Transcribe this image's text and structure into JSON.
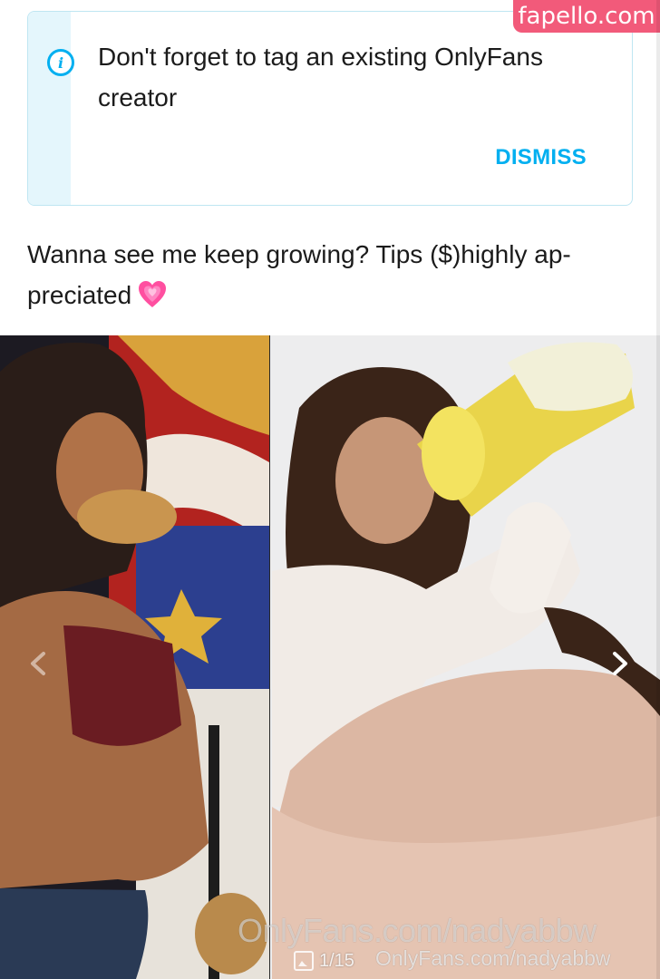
{
  "notice": {
    "icon": "info-icon",
    "message": "Don't forget to tag an existing OnlyFans creator",
    "dismiss_label": "DISMISS",
    "accent": "#00aff0"
  },
  "post": {
    "caption": "Wanna see me keep growing? Tips ($)highly ap-preciated",
    "caption_emoji": "growing-heart-icon"
  },
  "gallery": {
    "counter": "1/15",
    "watermark_large": "OnlyFans.com/nadyabbw",
    "watermark_small": "OnlyFans.com/nadyabbw",
    "prev_icon": "chevron-left-icon",
    "next_icon": "chevron-right-icon"
  },
  "site_badge": {
    "label": "fapello.com",
    "color": "#f25a7a"
  }
}
